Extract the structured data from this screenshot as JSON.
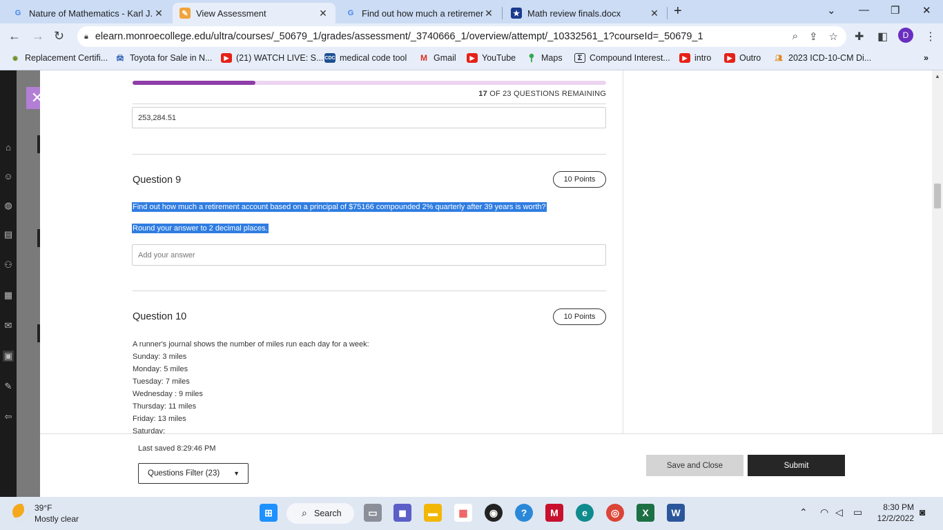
{
  "browser": {
    "tabs": [
      {
        "title": "Nature of Mathematics - Karl J. S",
        "icon": "google-icon",
        "active": false
      },
      {
        "title": "View Assessment",
        "icon": "blackboard-icon",
        "active": true
      },
      {
        "title": "Find out how much a retirement",
        "icon": "google-icon",
        "active": false
      },
      {
        "title": "Math review finals.docx",
        "icon": "document-star-icon",
        "active": false
      }
    ],
    "url": "elearn.monroecollege.edu/ultra/courses/_50679_1/grades/assessment/_3740666_1/overview/attempt/_10332561_1?courseId=_50679_1",
    "profile_initial": "D",
    "bookmarks": [
      "Replacement Certifi...",
      "Toyota for Sale in N...",
      "(21) WATCH LIVE: S...",
      "medical code tool",
      "Gmail",
      "YouTube",
      "Maps",
      "Compound Interest...",
      "intro",
      "Outro",
      "2023 ICD-10-CM Di..."
    ],
    "bookmark_icons": [
      "CDC"
    ]
  },
  "assessment": {
    "progress_fraction": 0.26,
    "remaining_count": "17",
    "remaining_text": "OF 23 QUESTIONS REMAINING",
    "previous_answer": "253,284.51",
    "questions": [
      {
        "title": "Question 9",
        "points": "10 Points",
        "text_line1": "Find out how much a retirement account based on a principal of $75166 compounded 2% quarterly after 39 years is worth?",
        "text_line2": "Round your answer to 2 decimal places.",
        "answer_placeholder": "Add your answer"
      },
      {
        "title": "Question 10",
        "points": "10 Points",
        "intro": "A runner's journal shows the number of miles run each day for a week:",
        "lines": [
          "Sunday: 3 miles",
          "Monday: 5 miles",
          "Tuesday: 7 miles",
          "Wednesday : 9 miles",
          "Thursday: 11 miles",
          "Friday: 13 miles",
          "Saturday:"
        ]
      }
    ],
    "footer": {
      "last_saved": "Last saved 8:29:46 PM",
      "filter_label": "Questions Filter (23)",
      "save_close_label": "Save and Close",
      "submit_label": "Submit"
    }
  },
  "taskbar": {
    "temperature": "39°F",
    "condition": "Mostly clear",
    "search_label": "Search",
    "time": "8:30 PM",
    "date": "12/2/2022"
  },
  "colors": {
    "accent_purple": "#8e3ea8",
    "highlight_blue": "#2f7de1",
    "tabstrip": "#cbdcf4"
  }
}
